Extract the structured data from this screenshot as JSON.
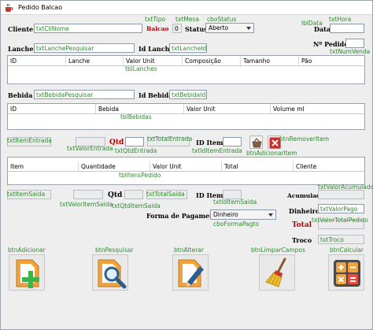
{
  "window": {
    "title": "Pedido Balcao"
  },
  "header": {
    "cliente_label": "Cliente",
    "cliente_field_tag": "txtCliNome",
    "tipo_tag": "txtTipo",
    "tipo_value": "Balcao",
    "mesa_tag": "txtMesa",
    "mesa_value": "0",
    "status_label": "Status",
    "status_tag": "cboStatus",
    "status_value": "Aberto",
    "data_tag": "lblData",
    "data_label": "Data",
    "hora_tag": "txtHora",
    "pedido_label": "Nº Pedido",
    "num_venda_tag": "txtNumVenda"
  },
  "lanche": {
    "label": "Lanche",
    "search_tag": "txtLanchePesquisar",
    "id_label": "Id Lanche",
    "id_tag": "txtLancheId",
    "table_tag": "tblLanches",
    "columns": [
      "ID",
      "Lanche",
      "Valor Unit",
      "Composição",
      "Tamanho",
      "Pão"
    ]
  },
  "bebida": {
    "label": "Bebida",
    "search_tag": "txtBebidaPesquisar",
    "id_label": "Id Bebida",
    "id_tag": "txtBebidaId",
    "table_tag": "tblBebidas",
    "columns": [
      "ID",
      "Bebida",
      "Valor Unit",
      "Volume ml"
    ]
  },
  "entrada": {
    "item_tag": "txtItemEntrada",
    "qtd_label": "Qtd",
    "total_tag": "txtTotalEntrada",
    "id_item_label": "ID Item",
    "valor_tag": "txtValorEntrada",
    "qtd_tag": "txtQtdEntrada",
    "id_tag": "txtIdItemEntrada",
    "add_tag": "btnAdicionarItem",
    "remove_tag": "btnRemoverItem"
  },
  "itens": {
    "table_tag": "tblItensPedido",
    "columns": [
      "Item",
      "Quantidade",
      "Valor Unit",
      "Total",
      "Cliente"
    ]
  },
  "saida": {
    "item_tag": "txtItemSaida",
    "qtd_label": "Qtd",
    "total_tag": "txtTotalSaida",
    "id_item_label": "ID Item",
    "valor_tag": "txtValorItemSaida",
    "qtd_tag": "txtQtdItemSaida",
    "id_tag": "txtIdItemSaida",
    "pagto_label": "Forma de Pagamento:",
    "pagto_value": "Dinheiro",
    "pagto_tag": "cboFormaPagto"
  },
  "totais": {
    "acumulado_label": "Acumulado",
    "acumulado_tag": "txtValorAcumulado",
    "dinheiro_label": "Dinheiro",
    "dinheiro_tag": "txtValorPago",
    "total_label": "Total",
    "total_tag": "txtValorTotalPedido",
    "troco_label": "Troco",
    "troco_tag": "txtTroco"
  },
  "actions": {
    "adicionar_tag": "btnAdicionar",
    "pesquisar_tag": "btnPesquisar",
    "alterar_tag": "btnAlterar",
    "limpar_tag": "btnLimparCampos",
    "calc_tag": "btnCalcular"
  },
  "colors": {
    "tag_green": "#2e8b2e",
    "label_red": "#b40000",
    "icon_orange": "#f0a23c",
    "icon_green": "#3ab54a"
  }
}
